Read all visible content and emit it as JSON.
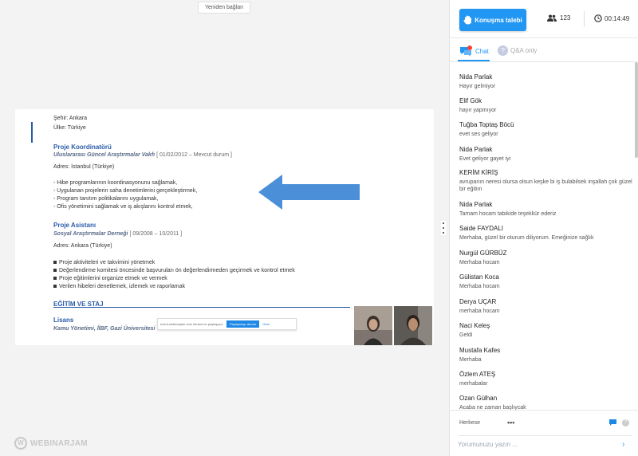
{
  "stage": {
    "reconnect_label": "Yeniden bağlan",
    "logo_text": "WEBINARJAM"
  },
  "cv": {
    "city": "Şehir: Ankara",
    "country": "Ülke: Türkiye",
    "job1_title": "Proje Koordinatörü",
    "job1_org": "Uluslararası Güncel Araştırmalar Vakfı",
    "job1_dates": "[ 01/02/2012 – Mevcut durum ]",
    "job1_addr": "Adres: İstanbul (Türkiye)",
    "job1_items": [
      "- Hibe programlarının koordinasyonunu sağlamak,",
      "- Uygulanan projelerin saha denetimlerini gerçekleştirmek,",
      "- Program tanıtım politikalarını uygulamak,",
      "- Ofis yönetimini sağlamak ve iş akışlarını kontrol etmek,"
    ],
    "job2_title": "Proje Asistanı",
    "job2_org": "Sosyal Araştırmalar Derneği",
    "job2_dates": "[ 09/2008 – 10/2011 ]",
    "job2_addr": "Adres: Ankara (Türkiye)",
    "job2_items": [
      "Proje aktiviteleri ve takvimini yönetmek",
      "Değerlendirme komitesi öncesinde başvuruları ön değerlendirmeden geçirmek ve kontrol etmek",
      "Proje eğitimlerini organize etmek ve vermek",
      "Verilen hibeleri denetlemek, izlemek ve raporlamak"
    ],
    "edu_title": "EĞİTİM VE STAJ",
    "edu_degree": "Lisans",
    "edu_school": "Kamu Yönetimi, İİBF, Gazi Üniversitesi"
  },
  "share_bar": {
    "text": "event.webinarjam.com ekranınızı paylaşıyor.",
    "stop_label": "Paylaşmayı durdur",
    "hide_label": "Gizle"
  },
  "panel": {
    "talk_label": "Konuşma talebi",
    "attendees": "123",
    "timer": "00:14:49",
    "tab_chat": "Chat",
    "tab_qa": "Q&A only",
    "audience": "Herkese",
    "more": "•••",
    "input_placeholder": "Yorumunuzu yazın ..."
  },
  "messages": [
    {
      "name": "Nida Parlak",
      "text": "Hayır gelmiyor"
    },
    {
      "name": "Elif Gök",
      "text": "hayır yapmıyor"
    },
    {
      "name": "Tuğba Toptaş Böcü",
      "text": "evet ses geliyor"
    },
    {
      "name": "Nida Parlak",
      "text": "Evet geliyor gayet iyi"
    },
    {
      "name": "KERİM KİRİŞ",
      "text": "avrupanın neresi olursa olsun keşke bi iş bulabilsek inşallah çok güzel bir eğitim"
    },
    {
      "name": "Nida Parlak",
      "text": "Tamam hocam tabikide teşekkür ederiz"
    },
    {
      "name": "Saide FAYDALI",
      "text": "Merhaba, güzel bir oturum diliyorum. Emeğinize sağlık"
    },
    {
      "name": "Nurgül GÜRBÜZ",
      "text": "Merhaba hocam"
    },
    {
      "name": "Gülistan Koca",
      "text": "Merhaba hocam"
    },
    {
      "name": "Derya UÇAR",
      "text": "merhaba hocam"
    },
    {
      "name": "Naci Keleş",
      "text": "Geldi"
    },
    {
      "name": "Mustafa Kafes",
      "text": "Merhaba"
    },
    {
      "name": "Özlem ATEŞ",
      "text": "merhabalar"
    },
    {
      "name": "Ozan Gülhan",
      "text": "Acaba ne zaman başlıycak"
    }
  ],
  "colors": {
    "accent": "#2196f3",
    "cv_heading": "#2a5ba8",
    "arrow": "#4a8fd8"
  }
}
